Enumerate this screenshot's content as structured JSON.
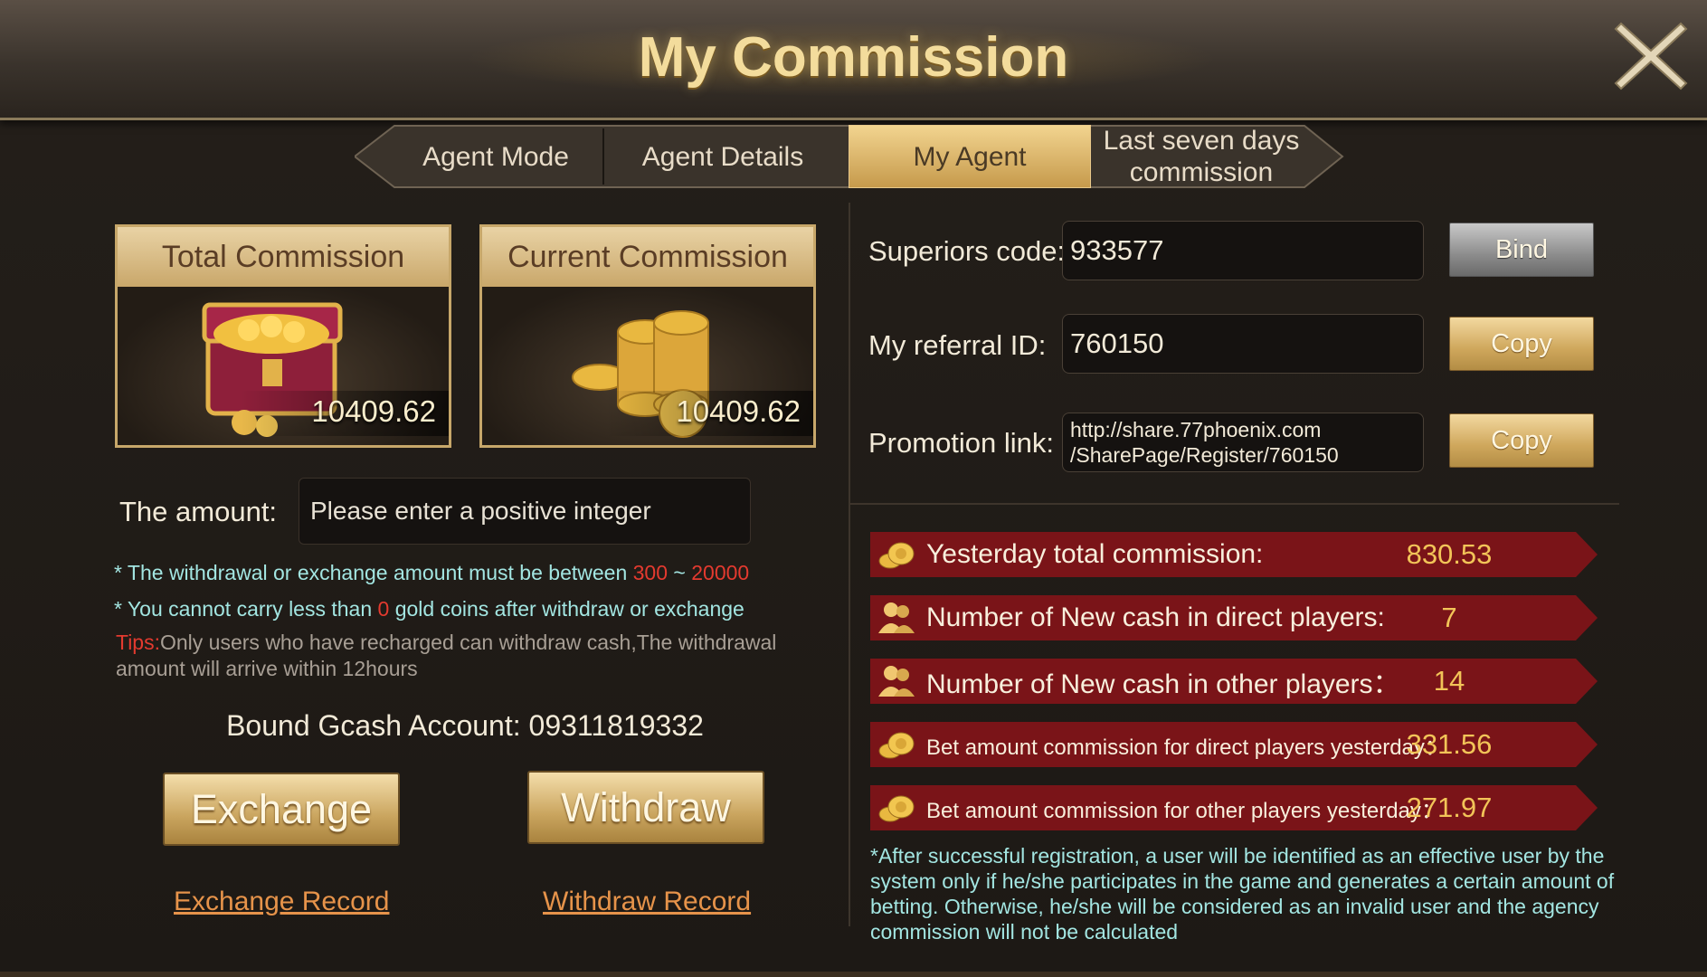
{
  "title": "My Commission",
  "tabs": [
    {
      "label": "Agent Mode",
      "active": false
    },
    {
      "label": "Agent Details",
      "active": false
    },
    {
      "label": "My Agent",
      "active": true
    },
    {
      "label": "Last seven days\ncommission",
      "active": false
    }
  ],
  "cards": {
    "total": {
      "header": "Total Commission",
      "value": "10409.62"
    },
    "current": {
      "header": "Current Commission",
      "value": "10409.62"
    }
  },
  "amount": {
    "label": "The amount:",
    "placeholder": "Please enter a positive integer"
  },
  "rules": {
    "line1_prefix": "* The withdrawal or exchange amount must be between ",
    "line1_min": "300",
    "line1_sep": " ~ ",
    "line1_max": "20000",
    "line2_prefix": "* You cannot carry less than ",
    "line2_value": "0",
    "line2_suffix": " gold coins after withdraw or exchange",
    "tips_label": "Tips:",
    "tips_text": "Only users who have recharged can withdraw cash,The withdrawal amount will arrive within 12hours"
  },
  "bound_account": "Bound Gcash Account: 09311819332",
  "buttons": {
    "exchange": "Exchange",
    "withdraw": "Withdraw",
    "exchange_record": "Exchange Record",
    "withdraw_record": "Withdraw Record"
  },
  "right": {
    "superiors_label": "Superiors code:",
    "superiors_value": "933577",
    "bind": "Bind",
    "referral_label": "My referral ID:",
    "referral_value": "760150",
    "copy": "Copy",
    "promo_label": "Promotion link:",
    "promo_line1": "http://share.77phoenix.com",
    "promo_line2": "/SharePage/Register/760150"
  },
  "stats": [
    {
      "label": "Yesterday total commission:",
      "value": "830.53",
      "icon": "coins-icon"
    },
    {
      "label": "Number of New cash in direct players:",
      "value": "7",
      "icon": "players-icon"
    },
    {
      "label": "Number of New cash in other players：",
      "value": "14",
      "icon": "players-icon"
    },
    {
      "label": "Bet amount commission for direct players yesterday：",
      "value": "331.56",
      "icon": "coins-icon"
    },
    {
      "label": "Bet amount commission for other players yesterday：",
      "value": "271.97",
      "icon": "coins-icon"
    }
  ],
  "note": "*After successful registration, a user will be identified as an effective user by the system only if he/she participates in the game and generates a certain amount of betting. Otherwise, he/she will be considered as an invalid user and the agency commission will not be calculated",
  "colors": {
    "accent_gold": "#f3dc9c",
    "stat_bar": "#7a1418",
    "stat_value": "#f2c458",
    "note_text": "#a3e6e2",
    "warning_red": "#e43a2f",
    "record_link": "#e6934a"
  }
}
